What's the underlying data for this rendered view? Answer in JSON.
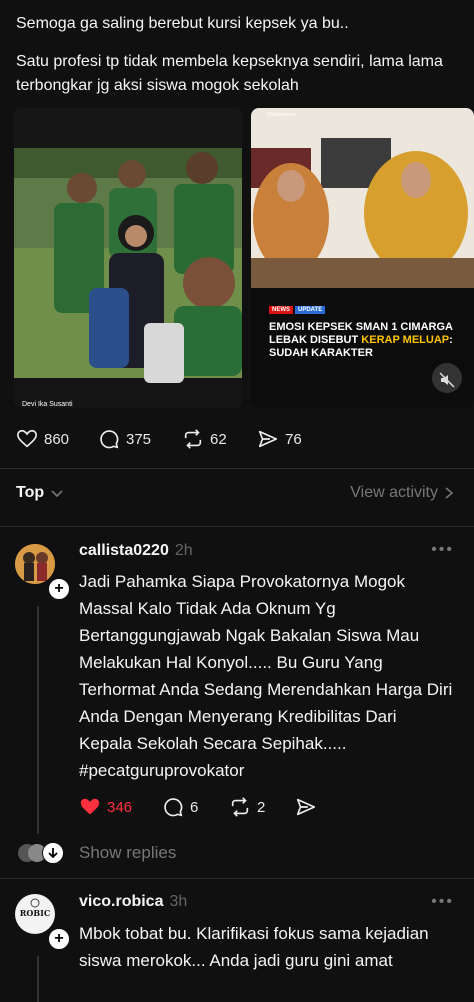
{
  "post": {
    "line1": "Semoga ga saling berebut kursi kepsek ya bu..",
    "line2": "Satu profesi tp tidak membela kepseknya sendiri, lama lama terbongkar jg aksi siswa mogok sekolah",
    "images": [
      {
        "caption": "Devi Ika Susanti"
      },
      {
        "source": "@lebaknews",
        "badge1": "NEWS",
        "badge2": "UPDATE",
        "headline_white": "EMOSI KEPSEK SMAN 1 CIMARGA LEBAK DISEBUT",
        "headline_yellow": "KERAP MELUAP",
        "headline_end": ": SUDAH KARAKTER"
      }
    ],
    "stats": {
      "likes": "860",
      "comments": "375",
      "reposts": "62",
      "shares": "76"
    }
  },
  "sort": {
    "label": "Top",
    "view_activity": "View activity"
  },
  "comments": [
    {
      "username": "callista0220",
      "time": "2h",
      "text": "Jadi Pahamka  Siapa Provokatornya Mogok Massal Kalo Tidak Ada Oknum Yg Bertanggungjawab Ngak Bakalan Siswa Mau Melakukan Hal Konyol..... Bu Guru Yang Terhormat Anda Sedang Merendahkan Harga Diri Anda Dengan Menyerang Kredibilitas Dari Kepala Sekolah Secara Sepihak..... #pecatguruprovokator",
      "likes": "346",
      "replies": "6",
      "reposts": "2",
      "show_replies": "Show replies"
    },
    {
      "username": "vico.robica",
      "time": "3h",
      "avatar_text": "ROBIC",
      "text": "Mbok tobat bu. Klarifikasi fokus sama kejadian siswa merokok... Anda jadi guru gini amat"
    }
  ],
  "colors": {
    "background": "#101010",
    "like_red": "#ff3040",
    "muted": "#777777"
  }
}
